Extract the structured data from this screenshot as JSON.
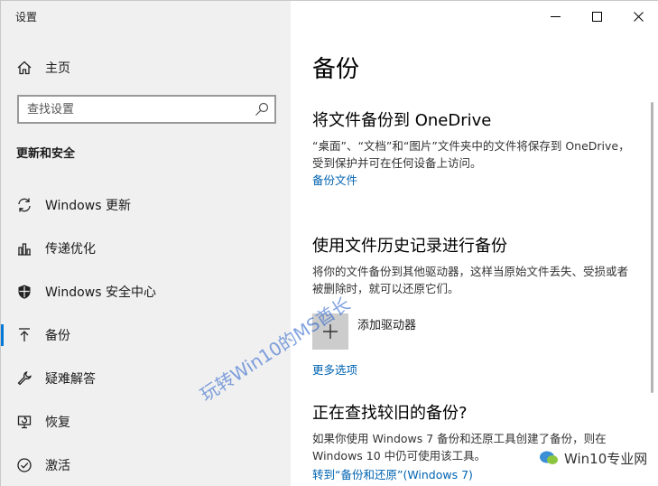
{
  "window": {
    "title": "设置",
    "controls": {
      "minimize_icon": "minimize-icon",
      "maximize_icon": "maximize-icon",
      "close_icon": "close-icon"
    }
  },
  "sidebar": {
    "home_label": "主页",
    "search": {
      "placeholder": "查找设置",
      "value": ""
    },
    "section_heading": "更新和安全",
    "items": [
      {
        "label": "Windows 更新",
        "icon": "sync-icon",
        "active": false
      },
      {
        "label": "传递优化",
        "icon": "delivery-optimization-icon",
        "active": false
      },
      {
        "label": "Windows 安全中心",
        "icon": "shield-icon",
        "active": false
      },
      {
        "label": "备份",
        "icon": "backup-arrow-icon",
        "active": true
      },
      {
        "label": "疑难解答",
        "icon": "wrench-icon",
        "active": false
      },
      {
        "label": "恢复",
        "icon": "recovery-icon",
        "active": false
      },
      {
        "label": "激活",
        "icon": "activation-icon",
        "active": false
      }
    ]
  },
  "main": {
    "title": "备份",
    "onedrive": {
      "heading": "将文件备份到 OneDrive",
      "desc": "“桌面”、“文档”和“图片”文件夹中的文件将保存到 OneDrive，受到保护并可在任何设备上访问。",
      "link": "备份文件"
    },
    "file_history": {
      "heading": "使用文件历史记录进行备份",
      "desc": "将你的文件备份到其他驱动器，这样当原始文件丢失、受损或者被删除时，就可以还原它们。",
      "add_drive_label": "添加驱动器",
      "more_options_link": "更多选项"
    },
    "older_backup": {
      "heading": "正在查找较旧的备份?",
      "desc": "如果你使用 Windows 7 备份和还原工具创建了备份，则在 Windows 10 中仍可使用该工具。",
      "link": "转到“备份和还原”(Windows 7)"
    }
  },
  "watermark": {
    "diagonal_text": "玩转Win10的MS酋长",
    "brand_text": "Win10专业网"
  },
  "colors": {
    "accent": "#0078d7",
    "link": "#0063b1",
    "sidebar_bg": "#f0f0f0"
  }
}
